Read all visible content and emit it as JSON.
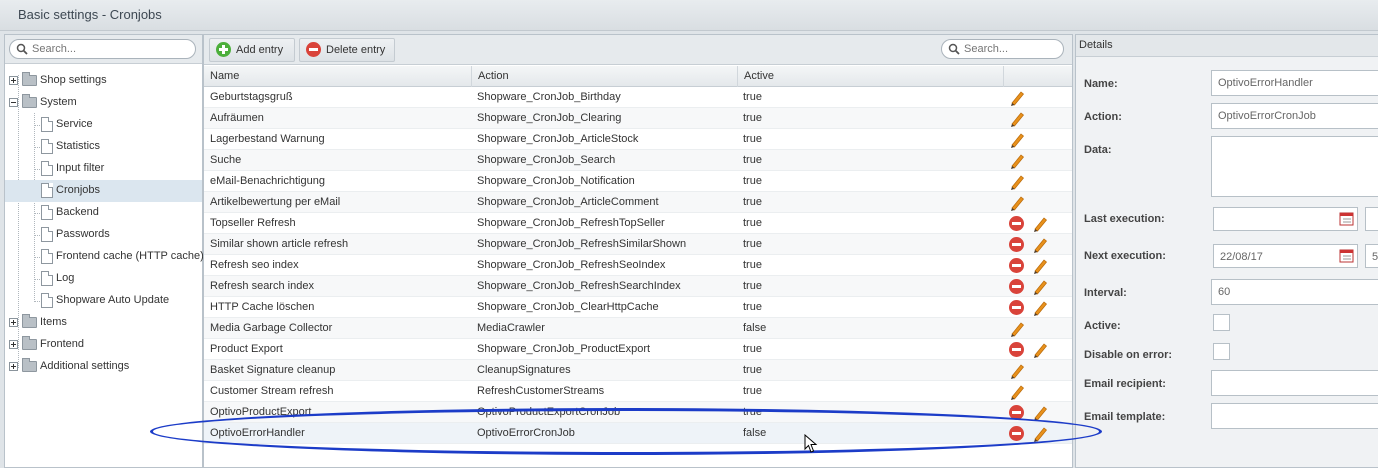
{
  "window": {
    "title": "Basic settings - Cronjobs"
  },
  "tree": {
    "search_placeholder": "Search...",
    "items": [
      {
        "label": "Shop settings",
        "type": "folder",
        "expanded": false
      },
      {
        "label": "System",
        "type": "folder",
        "expanded": true
      },
      {
        "label": "Service",
        "type": "leaf"
      },
      {
        "label": "Statistics",
        "type": "leaf"
      },
      {
        "label": "Input filter",
        "type": "leaf"
      },
      {
        "label": "Cronjobs",
        "type": "leaf",
        "selected": true
      },
      {
        "label": "Backend",
        "type": "leaf"
      },
      {
        "label": "Passwords",
        "type": "leaf"
      },
      {
        "label": "Frontend cache (HTTP cache)",
        "type": "leaf"
      },
      {
        "label": "Log",
        "type": "leaf"
      },
      {
        "label": "Shopware Auto Update",
        "type": "leaf"
      },
      {
        "label": "Items",
        "type": "folder",
        "expanded": false
      },
      {
        "label": "Frontend",
        "type": "folder",
        "expanded": false
      },
      {
        "label": "Additional settings",
        "type": "folder",
        "expanded": false
      }
    ]
  },
  "toolbar": {
    "add_label": "Add entry",
    "delete_label": "Delete entry",
    "search_placeholder": "Search..."
  },
  "grid": {
    "columns": [
      "Name",
      "Action",
      "Active"
    ],
    "rows": [
      {
        "name": "Geburtstagsgruß",
        "action": "Shopware_CronJob_Birthday",
        "active": "true",
        "deletable": false
      },
      {
        "name": "Aufräumen",
        "action": "Shopware_CronJob_Clearing",
        "active": "true",
        "deletable": false
      },
      {
        "name": "Lagerbestand Warnung",
        "action": "Shopware_CronJob_ArticleStock",
        "active": "true",
        "deletable": false
      },
      {
        "name": "Suche",
        "action": "Shopware_CronJob_Search",
        "active": "true",
        "deletable": false
      },
      {
        "name": "eMail-Benachrichtigung",
        "action": "Shopware_CronJob_Notification",
        "active": "true",
        "deletable": false
      },
      {
        "name": "Artikelbewertung per eMail",
        "action": "Shopware_CronJob_ArticleComment",
        "active": "true",
        "deletable": false
      },
      {
        "name": "Topseller Refresh",
        "action": "Shopware_CronJob_RefreshTopSeller",
        "active": "true",
        "deletable": true
      },
      {
        "name": "Similar shown article refresh",
        "action": "Shopware_CronJob_RefreshSimilarShown",
        "active": "true",
        "deletable": true
      },
      {
        "name": "Refresh seo index",
        "action": "Shopware_CronJob_RefreshSeoIndex",
        "active": "true",
        "deletable": true
      },
      {
        "name": "Refresh search index",
        "action": "Shopware_CronJob_RefreshSearchIndex",
        "active": "true",
        "deletable": true
      },
      {
        "name": "HTTP Cache löschen",
        "action": "Shopware_CronJob_ClearHttpCache",
        "active": "true",
        "deletable": true
      },
      {
        "name": "Media Garbage Collector",
        "action": "MediaCrawler",
        "active": "false",
        "deletable": false
      },
      {
        "name": "Product Export",
        "action": "Shopware_CronJob_ProductExport",
        "active": "true",
        "deletable": true
      },
      {
        "name": "Basket Signature cleanup",
        "action": "CleanupSignatures",
        "active": "true",
        "deletable": false
      },
      {
        "name": "Customer Stream refresh",
        "action": "RefreshCustomerStreams",
        "active": "true",
        "deletable": false
      },
      {
        "name": "OptivoProductExport",
        "action": "OptivoProductExportCronJob",
        "active": "true",
        "deletable": true
      },
      {
        "name": "OptivoErrorHandler",
        "action": "OptivoErrorCronJob",
        "active": "false",
        "deletable": true,
        "selected": true
      }
    ]
  },
  "details": {
    "header": "Details",
    "name_label": "Name:",
    "name_value": "OptivoErrorHandler",
    "action_label": "Action:",
    "action_value": "OptivoErrorCronJob",
    "data_label": "Data:",
    "data_value": "",
    "last_exec_label": "Last execution:",
    "last_exec_date": "",
    "next_exec_label": "Next execution:",
    "next_exec_date": "22/08/17",
    "next_exec_time": "5",
    "interval_label": "Interval:",
    "interval_value": "60",
    "active_label": "Active:",
    "disable_label": "Disable on error:",
    "email_recipient_label": "Email recipient:",
    "email_recipient_value": "",
    "email_template_label": "Email template:",
    "email_template_value": ""
  },
  "colors": {
    "annotation_ellipse": "#1c3cc8",
    "delete_red": "#d9433a",
    "add_green": "#4caf3b",
    "edit_orange": "#e8911c"
  }
}
